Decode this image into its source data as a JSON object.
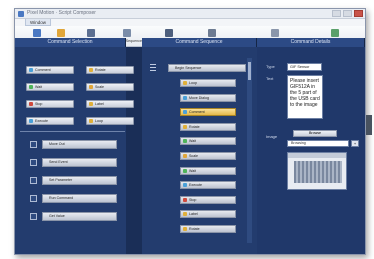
{
  "window": {
    "title": "Pixel Motion · Script Composer"
  },
  "menu": {
    "active_label": "Window"
  },
  "toolbar": [
    {
      "label": "New",
      "icon": "new-doc-icon",
      "color": "#4a78c2"
    },
    {
      "label": "Open",
      "icon": "folder-icon",
      "color": "#e0a63a"
    },
    {
      "label": "Save",
      "icon": "save-icon",
      "color": "#5c6f91"
    },
    {
      "label": "Validate Sequence",
      "icon": "validate-icon",
      "color": "#7b8da9"
    },
    {
      "label": "Execution Configuration",
      "icon": "config-icon",
      "color": "#4e5f7d"
    },
    {
      "label": "Console Settings",
      "icon": "console-icon",
      "color": "#6d7b92"
    },
    {
      "label": "Import Settings",
      "icon": "import-icon",
      "color": "#8a96ab"
    },
    {
      "label": "Import Toolbar",
      "icon": "toolbar-import-icon",
      "color": "#5aa06a"
    }
  ],
  "panels": {
    "library_title": "Command Selection",
    "sequence_title": "Command Sequence",
    "details_title": "Command Details"
  },
  "library": {
    "buttons": [
      {
        "label": "Comment",
        "color": "#4aa0d8"
      },
      {
        "label": "Rotate",
        "color": "#e0b03a"
      },
      {
        "label": "Wait",
        "color": "#4fb45a"
      },
      {
        "label": "Scale",
        "color": "#e0a63a"
      },
      {
        "label": "Stop",
        "color": "#cf4a3e"
      },
      {
        "label": "Label",
        "color": "#e0b03a"
      },
      {
        "label": "Execute",
        "color": "#4aa0d8"
      },
      {
        "label": "Loop",
        "color": "#e0b03a"
      }
    ],
    "commands": [
      {
        "label": "Move Out",
        "icon": "monitor-icon"
      },
      {
        "label": "Send Event",
        "icon": "event-icon"
      },
      {
        "label": "Set Parameter",
        "icon": "parameter-icon"
      },
      {
        "label": "Run Command",
        "icon": "run-icon"
      },
      {
        "label": "Get Value",
        "icon": "value-icon"
      }
    ]
  },
  "sequence": {
    "header": "Begin Sequence",
    "items": [
      {
        "label": "Loop",
        "value": "",
        "color": "#e0b03a"
      },
      {
        "label": "Move Dialog",
        "value": "",
        "color": "#4aa0d8"
      },
      {
        "label": "Comment",
        "value": "",
        "color": "#4aa0d8",
        "selected": true
      },
      {
        "label": "Rotate",
        "value": "",
        "color": "#e0b03a"
      },
      {
        "label": "Wait",
        "value": "",
        "color": "#4fb45a"
      },
      {
        "label": "Scale",
        "value": "",
        "color": "#e0a63a"
      },
      {
        "label": "Wait",
        "value": "",
        "color": "#4fb45a"
      },
      {
        "label": "Execute",
        "value": "",
        "color": "#4aa0d8"
      },
      {
        "label": "Stop",
        "value": "",
        "color": "#cf4a3e"
      },
      {
        "label": "Label",
        "value": "",
        "color": "#e0b03a"
      },
      {
        "label": "Rotate",
        "value": "",
        "color": "#e0b03a"
      }
    ]
  },
  "details": {
    "type_label": "Type",
    "type_value": "GIF Sensor",
    "text_label": "Text",
    "text_value": "Please insert GIF512A in the 5 part of the USB card to the image",
    "image_label": "Image",
    "image_button": "Browse",
    "image_select": "Browsing"
  },
  "colors": {
    "window_bg": "#1f3563",
    "panel_header": "#2c4a85",
    "selection": "#e5b94a"
  }
}
